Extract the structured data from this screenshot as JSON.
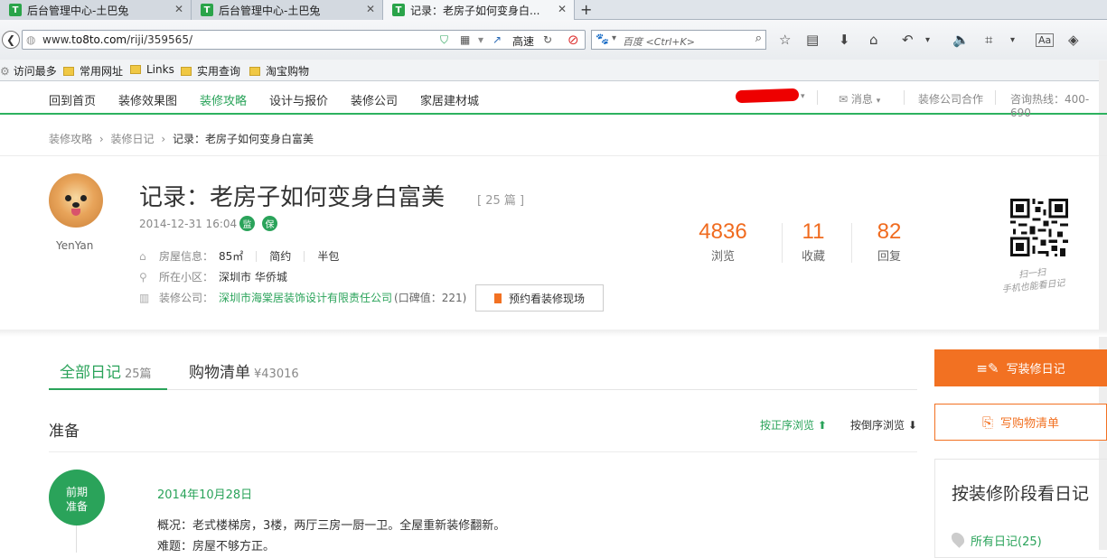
{
  "browser": {
    "tabs": [
      {
        "title": "后台管理中心-土巴兔",
        "favicon": "T"
      },
      {
        "title": "后台管理中心-土巴兔",
        "favicon": "T"
      },
      {
        "title": "记录：老房子如何变身白...",
        "favicon": "T"
      }
    ],
    "url_prefix": "www.",
    "url_host": "to8to.com",
    "url_path": "/riji/359565/",
    "speed_label": "高速",
    "search_placeholder": "百度 <Ctrl+K>",
    "bookmarks": [
      "访问最多",
      "常用网址",
      "Links",
      "实用查询",
      "淘宝购物"
    ]
  },
  "site_nav": {
    "items": [
      "回到首页",
      "装修效果图",
      "装修攻略",
      "设计与报价",
      "装修公司",
      "家居建材城"
    ],
    "active_index": 2,
    "message_label": "消息",
    "cooperation_label": "装修公司合作",
    "hotline_label": "咨询热线：400-690"
  },
  "breadcrumb": [
    "装修攻略",
    "装修日记",
    "记录：老房子如何变身白富美"
  ],
  "diary": {
    "author": "YenYan",
    "title": "记录：老房子如何变身白富美",
    "count_label": "[ 25 篇 ]",
    "date": "2014-12-31 16:04",
    "badges": [
      "监",
      "保"
    ],
    "house_label": "房屋信息：",
    "house_area": "85㎡",
    "house_style": "简约",
    "house_type": "半包",
    "community_label": "所在小区：",
    "community_value": "深圳市 华侨城",
    "company_label": "装修公司：",
    "company_value": "深圳市海棠居装饰设计有限责任公司",
    "company_rating": "(口碑值：221)",
    "appoint_label": "预约看装修现场",
    "stats": [
      {
        "value": "4836",
        "label": "浏览"
      },
      {
        "value": "11",
        "label": "收藏"
      },
      {
        "value": "82",
        "label": "回复"
      }
    ],
    "qr_caption_1": "扫一扫",
    "qr_caption_2": "手机也能看日记"
  },
  "content_tabs": {
    "all_label": "全部日记",
    "all_count": "25篇",
    "shopping_label": "购物清单",
    "shopping_amount": "¥43016"
  },
  "section": {
    "title": "准备",
    "sort_asc": "按正序浏览 ⬆",
    "sort_desc": "按倒序浏览 ⬇"
  },
  "entry": {
    "stage_1": "前期",
    "stage_2": "准备",
    "date": "2014年10月28日",
    "line1": "概况：老式楼梯房，3楼，两厅三房一厨一卫。全屋重新装修翻新。",
    "line2": "难题：房屋不够方正。"
  },
  "sidebar": {
    "write_label": "写装修日记",
    "shop_label": "写购物清单",
    "panel_title": "按装修阶段看日记",
    "all_entries": "所有日记(25)"
  },
  "colors": {
    "brand_green": "#2aa35a",
    "accent_orange": "#f27122"
  }
}
